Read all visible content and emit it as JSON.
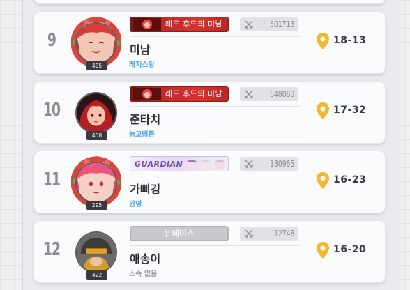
{
  "entries": [
    {
      "rank": "9",
      "name": "미남",
      "level": "405",
      "title": "레드 후드의 미남",
      "title_style": "red",
      "power": "501718",
      "guild": "레지스탕",
      "guild_color": "#49a6e6",
      "coords": "18-13",
      "avatar": "red-haired-girl-with-flower-wreath"
    },
    {
      "rank": "10",
      "name": "준타치",
      "level": "468",
      "title": "레드 후드의 미남",
      "title_style": "red",
      "power": "648060",
      "guild": "늙고병든",
      "guild_color": "#49a6e6",
      "coords": "17-32",
      "avatar": "red-haired-girl"
    },
    {
      "rank": "11",
      "name": "가삐깅",
      "level": "295",
      "title": "GUARDIAN",
      "title_style": "guardian",
      "power": "180965",
      "guild": "완영",
      "guild_color": "#49a6e6",
      "coords": "16-23",
      "avatar": "pink-haired-girl-with-flower-wreath"
    },
    {
      "rank": "12",
      "name": "애송이",
      "level": "422",
      "title": "뉴페이스",
      "title_style": "plain",
      "power": "12748",
      "guild": "소속 없음",
      "guild_color": "#9a9ba2",
      "coords": "16-20",
      "avatar": "armored-character-in-helmet"
    }
  ],
  "colors": {
    "pin": "#f5b731",
    "red_banner": "#c12a2a"
  },
  "icons": {
    "power": "crossed-swords-icon",
    "location": "location-pin-icon"
  }
}
